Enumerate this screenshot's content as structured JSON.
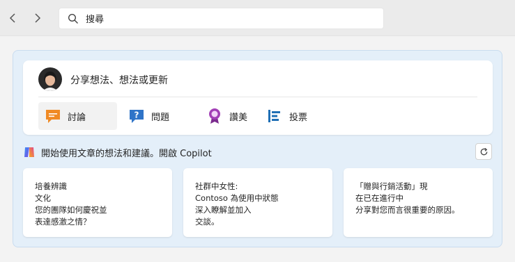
{
  "nav": {
    "back_icon": "chevron-left-icon",
    "forward_icon": "chevron-right-icon"
  },
  "search": {
    "placeholder": "搜尋"
  },
  "composer": {
    "prompt": "分享想法、想法或更新",
    "tabs": [
      {
        "label": "討論",
        "icon": "discussion-icon",
        "color": "#f08a24",
        "selected": true
      },
      {
        "label": "問題",
        "icon": "question-icon",
        "color": "#2f74c8"
      },
      {
        "label": "讚美",
        "icon": "praise-badge-icon",
        "color": "#a23fb6"
      },
      {
        "label": "投票",
        "icon": "poll-icon",
        "color": "#1f6fb5"
      }
    ]
  },
  "copilot": {
    "text": "開始使用文章的想法和建議。開啟 Copilot",
    "refresh_icon": "refresh-icon"
  },
  "suggestions": [
    {
      "lines": [
        "培養辨識",
        "文化",
        "您的團隊如何慶祝並",
        "表達感激之情？"
      ]
    },
    {
      "lines": [
        "社群中女性:",
        "Contoso 為使用中狀態",
        "深入瞭解並加入",
        "交談。"
      ]
    },
    {
      "lines": [
        "「贈與行銷活動」現",
        "在已在進行中",
        "分享對您而言很重要的原因。"
      ]
    }
  ],
  "colors": {
    "panel_bg": "#e4eff9",
    "accent": "#0f6cbd"
  }
}
